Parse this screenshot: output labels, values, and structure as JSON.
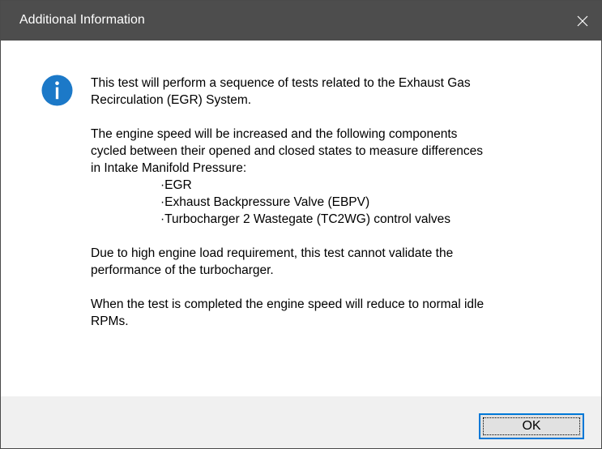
{
  "window": {
    "title": "Additional Information",
    "close_icon": "close-icon"
  },
  "colors": {
    "titlebar": "#4d4d4d",
    "info_icon": "#1c79c8",
    "footer": "#f0f0f0",
    "button_border": "#0078d7"
  },
  "icon": {
    "name": "info-icon",
    "glyph": "i"
  },
  "message": {
    "para1": [
      "This test will perform a sequence of tests related to the Exhaust Gas",
      "Recirculation (EGR) System."
    ],
    "para2": [
      "The engine speed will be increased and the following components",
      "cycled between their opened and closed states to measure differences",
      "in Intake Manifold Pressure:"
    ],
    "bullets": [
      "·EGR",
      "·Exhaust Backpressure Valve (EBPV)",
      "·Turbocharger 2 Wastegate (TC2WG) control valves"
    ],
    "para3": [
      "Due to high engine load requirement, this test cannot validate the",
      "performance of the turbocharger."
    ],
    "para4": [
      "When the test is completed the engine speed will reduce to normal idle",
      "RPMs."
    ]
  },
  "buttons": {
    "ok_label": "OK"
  }
}
